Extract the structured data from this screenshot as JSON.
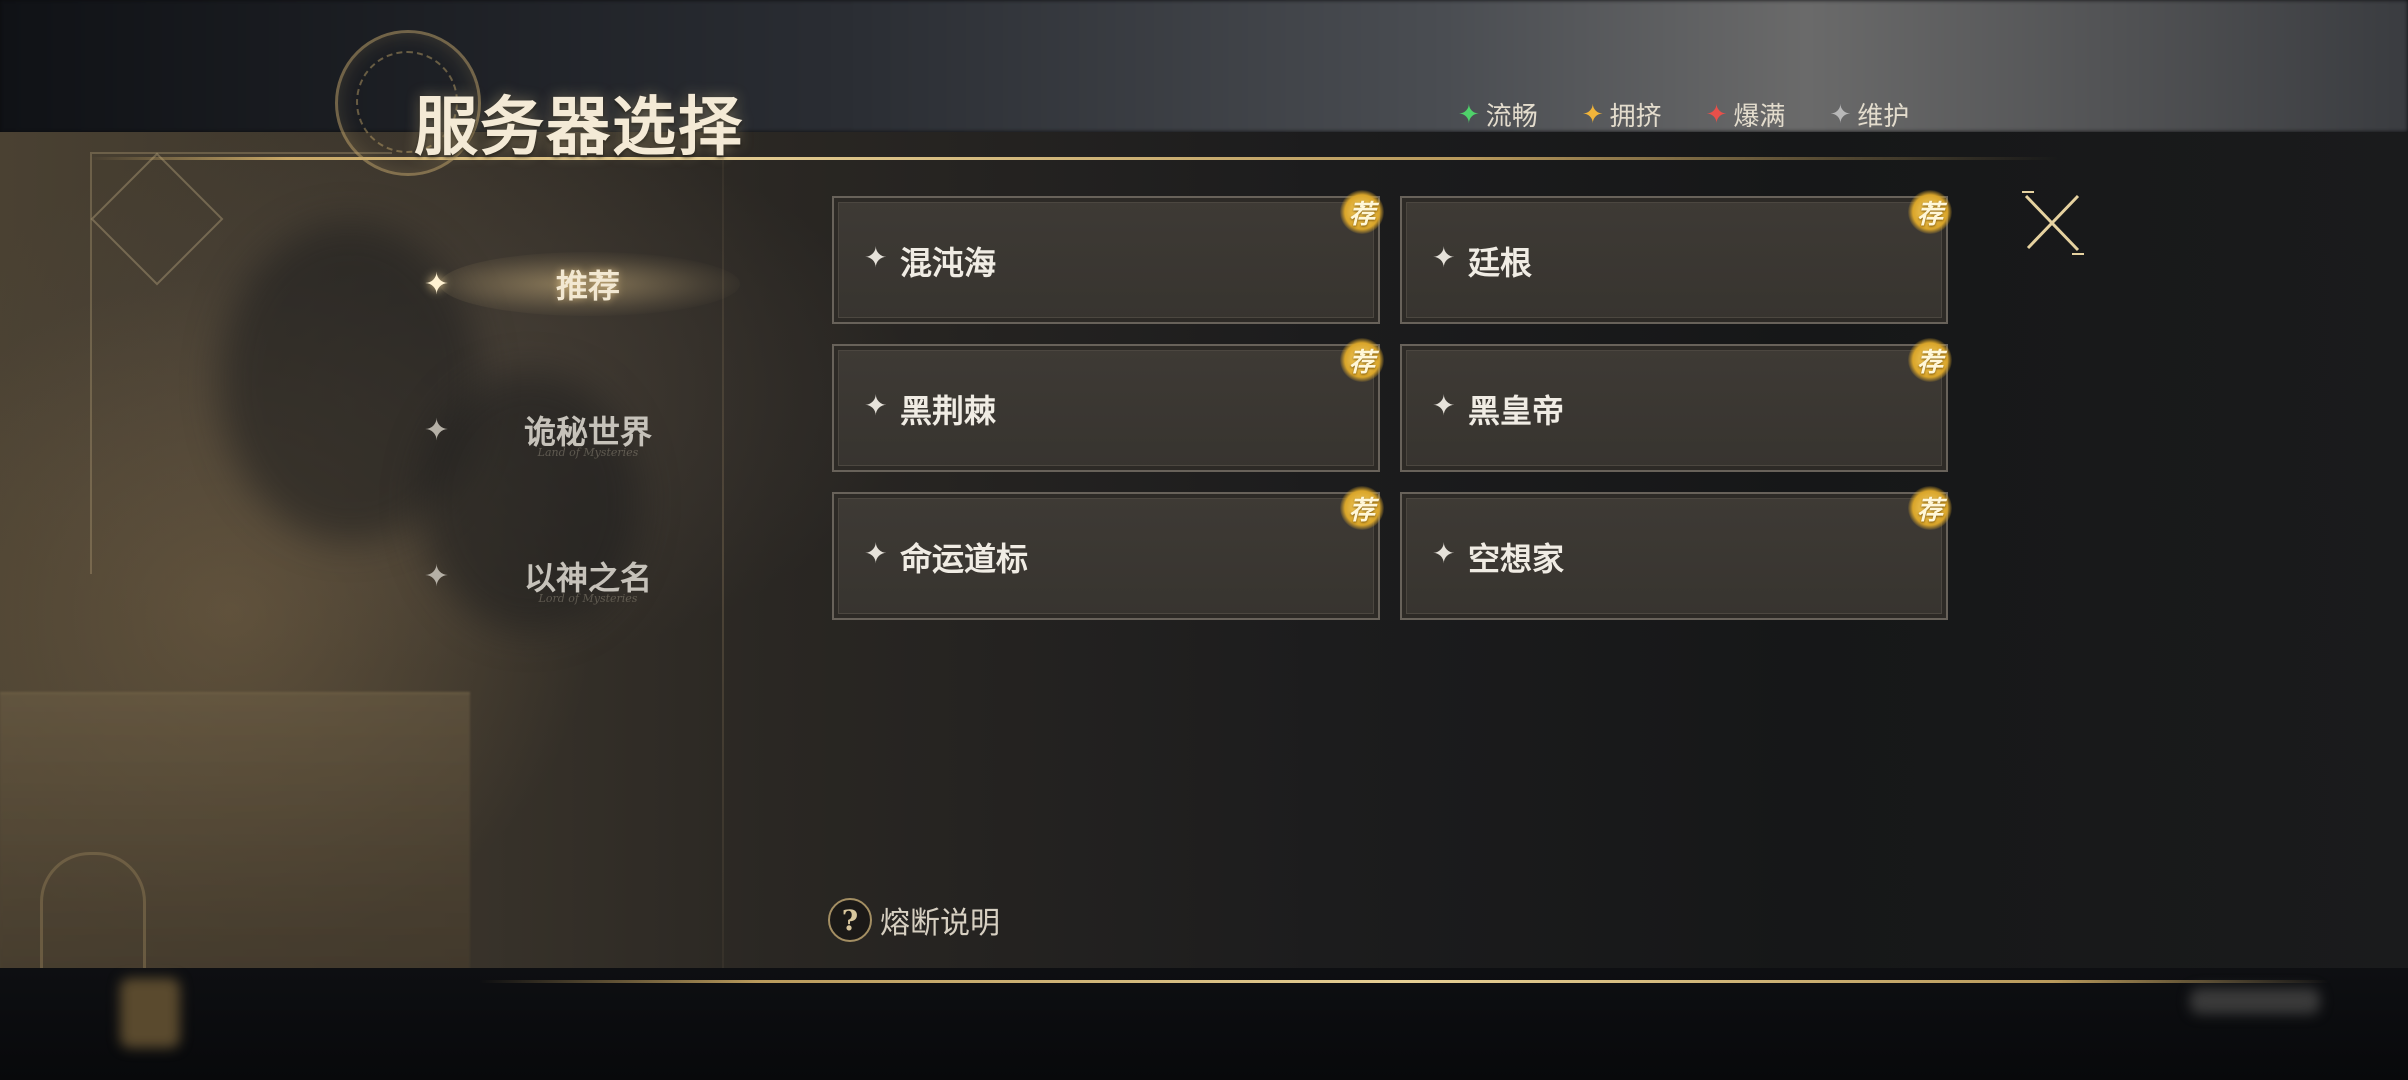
{
  "header": {
    "title": "服务器选择"
  },
  "legend": [
    {
      "label": "流畅",
      "color": "#4fd26a"
    },
    {
      "label": "拥挤",
      "color": "#f1b43a"
    },
    {
      "label": "爆满",
      "color": "#e8504a"
    },
    {
      "label": "维护",
      "color": "#b8b8b8"
    }
  ],
  "sidebar": {
    "items": [
      {
        "label": "推荐",
        "subtitle": "",
        "active": true
      },
      {
        "label": "诡秘世界",
        "subtitle": "Land of Mysteries"
      },
      {
        "label": "以神之名",
        "subtitle": "Lord of Mysteries"
      }
    ]
  },
  "servers": [
    {
      "name": "混沌海",
      "badge": "荐"
    },
    {
      "name": "廷根",
      "badge": "荐"
    },
    {
      "name": "黑荆棘",
      "badge": "荐"
    },
    {
      "name": "黑皇帝",
      "badge": "荐"
    },
    {
      "name": "命运道标",
      "badge": "荐"
    },
    {
      "name": "空想家",
      "badge": "荐"
    }
  ],
  "footer": {
    "help_label": "熔断说明",
    "help_icon": "question-icon"
  },
  "icons": {
    "close": "close-icon",
    "status": "sparkle-star-icon"
  },
  "colors": {
    "gold_accent": "#c9a866",
    "title": "#f4ead6"
  }
}
